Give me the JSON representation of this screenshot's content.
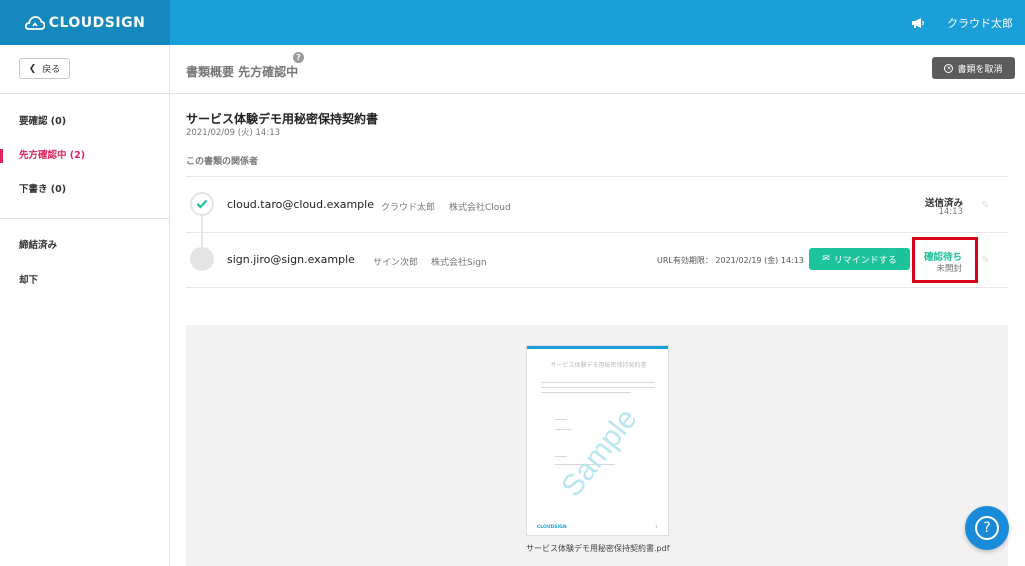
{
  "header": {
    "brand": "CLOUDSIGN",
    "user_name": "クラウド太郎"
  },
  "subheader": {
    "back_label": "戻る",
    "page_title": "書類概要 先方確認中",
    "help_mark": "?",
    "cancel_label": "書類を取消"
  },
  "sidebar": {
    "items": [
      {
        "label": "要確認 (0)"
      },
      {
        "label": "先方確認中 (2)"
      },
      {
        "label": "下書き (0)"
      },
      {
        "label": "締結済み"
      },
      {
        "label": "却下"
      }
    ]
  },
  "document": {
    "title": "サービス体験デモ用秘密保持契約書",
    "date": "2021/02/09 (火) 14:13",
    "section_label": "この書類の関係者"
  },
  "participants": [
    {
      "email": "cloud.taro@cloud.example",
      "name": "クラウド太郎",
      "company": "株式会社Cloud",
      "status": "送信済み",
      "status_sub": "14:13"
    },
    {
      "email": "sign.jiro@sign.example",
      "name": "サイン次郎",
      "company": "株式会社Sign",
      "url_expiry": "URL有効期限： 2021/02/19 (金) 14:13",
      "remind_label": "リマインドする",
      "status": "確認待ち",
      "status_sub": "未開封"
    }
  ],
  "preview": {
    "paper_title": "サービス体験デモ用秘密保持契約書",
    "watermark": "Sample",
    "paper_logo": "CLOUDSIGN",
    "paper_page": "1",
    "filename": "サービス体験デモ用秘密保持契約書.pdf"
  },
  "help_fab": {
    "label": "?"
  },
  "colors": {
    "header": "#1a9fd9",
    "active": "#e0245e",
    "remind": "#1dc39b",
    "highlight": "#d9001b"
  }
}
